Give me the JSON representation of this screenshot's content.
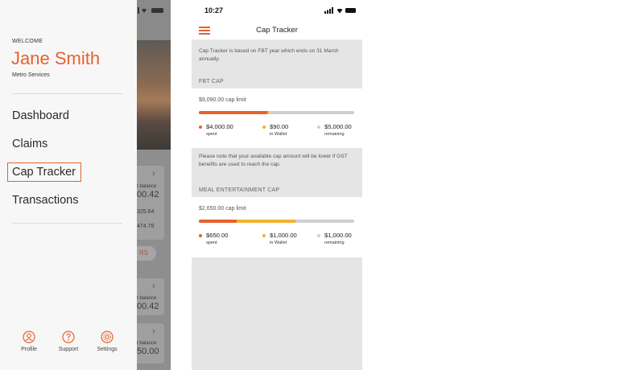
{
  "colors": {
    "accent": "#e8612c",
    "wallet": "#f0b232",
    "remaining": "#cfcfcf"
  },
  "drawer": {
    "welcome": "WELCOME",
    "user_name": "Jane Smith",
    "company": "Metro Services",
    "nav": [
      {
        "label": "Dashboard",
        "active": false
      },
      {
        "label": "Claims",
        "active": false
      },
      {
        "label": "Cap Tracker",
        "active": true
      },
      {
        "label": "Transactions",
        "active": false
      }
    ],
    "footer": [
      {
        "label": "Profile",
        "icon": "person-icon"
      },
      {
        "label": "Support",
        "icon": "question-icon"
      },
      {
        "label": "Settings",
        "icon": "gear-icon"
      }
    ]
  },
  "background_app": {
    "balance_label_1": "t balance",
    "balance_value_1": "00.42",
    "line_value_1": "325.64",
    "line_value_2": "474.78",
    "pill_text": "RS",
    "balance_label_2": "t balance",
    "balance_value_2": "00.42",
    "balance_label_3": "t balance",
    "balance_value_3": "50.00"
  },
  "screen": {
    "time": "10:27",
    "title": "Cap Tracker",
    "intro": "Cap Tracker is based on FBT year which ends on 31 March annually.",
    "fbt": {
      "heading": "FBT CAP",
      "limit": "$9,090.00 cap limit",
      "spent_fraction": 0.44,
      "wallet_fraction": 0.01,
      "stats": [
        {
          "amount": "$4,000.00",
          "label": "spent",
          "kind": "spent"
        },
        {
          "amount": "$90.00",
          "label": "in Wallet",
          "kind": "wallet"
        },
        {
          "amount": "$5,000.00",
          "label": "remaining",
          "kind": "remaining"
        }
      ]
    },
    "note": "Please note that your available cap amount will be lower if GST benefits are used to reach the cap.",
    "meal": {
      "heading": "MEAL ENTERTAINMENT CAP",
      "limit": "$2,650.00 cap limit",
      "spent_fraction": 0.245,
      "wallet_fraction": 0.377,
      "stats": [
        {
          "amount": "$650.00",
          "label": "spent",
          "kind": "spent"
        },
        {
          "amount": "$1,000.00",
          "label": "in Wallet",
          "kind": "wallet"
        },
        {
          "amount": "$1,000.00",
          "label": "remaining",
          "kind": "remaining"
        }
      ]
    }
  }
}
